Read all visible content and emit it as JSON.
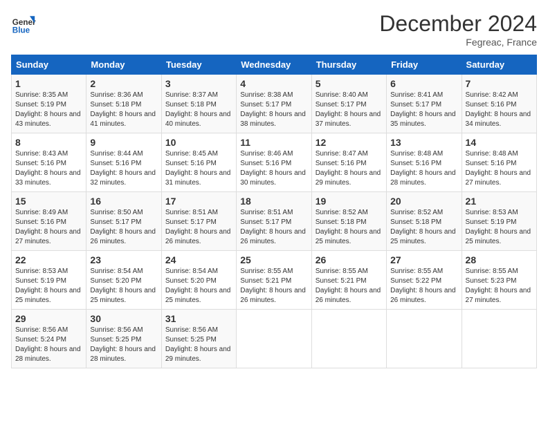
{
  "header": {
    "logo_line1": "General",
    "logo_line2": "Blue",
    "month": "December 2024",
    "location": "Fegreac, France"
  },
  "weekdays": [
    "Sunday",
    "Monday",
    "Tuesday",
    "Wednesday",
    "Thursday",
    "Friday",
    "Saturday"
  ],
  "weeks": [
    [
      {
        "day": "1",
        "sunrise": "Sunrise: 8:35 AM",
        "sunset": "Sunset: 5:19 PM",
        "daylight": "Daylight: 8 hours and 43 minutes."
      },
      {
        "day": "2",
        "sunrise": "Sunrise: 8:36 AM",
        "sunset": "Sunset: 5:18 PM",
        "daylight": "Daylight: 8 hours and 41 minutes."
      },
      {
        "day": "3",
        "sunrise": "Sunrise: 8:37 AM",
        "sunset": "Sunset: 5:18 PM",
        "daylight": "Daylight: 8 hours and 40 minutes."
      },
      {
        "day": "4",
        "sunrise": "Sunrise: 8:38 AM",
        "sunset": "Sunset: 5:17 PM",
        "daylight": "Daylight: 8 hours and 38 minutes."
      },
      {
        "day": "5",
        "sunrise": "Sunrise: 8:40 AM",
        "sunset": "Sunset: 5:17 PM",
        "daylight": "Daylight: 8 hours and 37 minutes."
      },
      {
        "day": "6",
        "sunrise": "Sunrise: 8:41 AM",
        "sunset": "Sunset: 5:17 PM",
        "daylight": "Daylight: 8 hours and 35 minutes."
      },
      {
        "day": "7",
        "sunrise": "Sunrise: 8:42 AM",
        "sunset": "Sunset: 5:16 PM",
        "daylight": "Daylight: 8 hours and 34 minutes."
      }
    ],
    [
      {
        "day": "8",
        "sunrise": "Sunrise: 8:43 AM",
        "sunset": "Sunset: 5:16 PM",
        "daylight": "Daylight: 8 hours and 33 minutes."
      },
      {
        "day": "9",
        "sunrise": "Sunrise: 8:44 AM",
        "sunset": "Sunset: 5:16 PM",
        "daylight": "Daylight: 8 hours and 32 minutes."
      },
      {
        "day": "10",
        "sunrise": "Sunrise: 8:45 AM",
        "sunset": "Sunset: 5:16 PM",
        "daylight": "Daylight: 8 hours and 31 minutes."
      },
      {
        "day": "11",
        "sunrise": "Sunrise: 8:46 AM",
        "sunset": "Sunset: 5:16 PM",
        "daylight": "Daylight: 8 hours and 30 minutes."
      },
      {
        "day": "12",
        "sunrise": "Sunrise: 8:47 AM",
        "sunset": "Sunset: 5:16 PM",
        "daylight": "Daylight: 8 hours and 29 minutes."
      },
      {
        "day": "13",
        "sunrise": "Sunrise: 8:48 AM",
        "sunset": "Sunset: 5:16 PM",
        "daylight": "Daylight: 8 hours and 28 minutes."
      },
      {
        "day": "14",
        "sunrise": "Sunrise: 8:48 AM",
        "sunset": "Sunset: 5:16 PM",
        "daylight": "Daylight: 8 hours and 27 minutes."
      }
    ],
    [
      {
        "day": "15",
        "sunrise": "Sunrise: 8:49 AM",
        "sunset": "Sunset: 5:16 PM",
        "daylight": "Daylight: 8 hours and 27 minutes."
      },
      {
        "day": "16",
        "sunrise": "Sunrise: 8:50 AM",
        "sunset": "Sunset: 5:17 PM",
        "daylight": "Daylight: 8 hours and 26 minutes."
      },
      {
        "day": "17",
        "sunrise": "Sunrise: 8:51 AM",
        "sunset": "Sunset: 5:17 PM",
        "daylight": "Daylight: 8 hours and 26 minutes."
      },
      {
        "day": "18",
        "sunrise": "Sunrise: 8:51 AM",
        "sunset": "Sunset: 5:17 PM",
        "daylight": "Daylight: 8 hours and 26 minutes."
      },
      {
        "day": "19",
        "sunrise": "Sunrise: 8:52 AM",
        "sunset": "Sunset: 5:18 PM",
        "daylight": "Daylight: 8 hours and 25 minutes."
      },
      {
        "day": "20",
        "sunrise": "Sunrise: 8:52 AM",
        "sunset": "Sunset: 5:18 PM",
        "daylight": "Daylight: 8 hours and 25 minutes."
      },
      {
        "day": "21",
        "sunrise": "Sunrise: 8:53 AM",
        "sunset": "Sunset: 5:19 PM",
        "daylight": "Daylight: 8 hours and 25 minutes."
      }
    ],
    [
      {
        "day": "22",
        "sunrise": "Sunrise: 8:53 AM",
        "sunset": "Sunset: 5:19 PM",
        "daylight": "Daylight: 8 hours and 25 minutes."
      },
      {
        "day": "23",
        "sunrise": "Sunrise: 8:54 AM",
        "sunset": "Sunset: 5:20 PM",
        "daylight": "Daylight: 8 hours and 25 minutes."
      },
      {
        "day": "24",
        "sunrise": "Sunrise: 8:54 AM",
        "sunset": "Sunset: 5:20 PM",
        "daylight": "Daylight: 8 hours and 25 minutes."
      },
      {
        "day": "25",
        "sunrise": "Sunrise: 8:55 AM",
        "sunset": "Sunset: 5:21 PM",
        "daylight": "Daylight: 8 hours and 26 minutes."
      },
      {
        "day": "26",
        "sunrise": "Sunrise: 8:55 AM",
        "sunset": "Sunset: 5:21 PM",
        "daylight": "Daylight: 8 hours and 26 minutes."
      },
      {
        "day": "27",
        "sunrise": "Sunrise: 8:55 AM",
        "sunset": "Sunset: 5:22 PM",
        "daylight": "Daylight: 8 hours and 26 minutes."
      },
      {
        "day": "28",
        "sunrise": "Sunrise: 8:55 AM",
        "sunset": "Sunset: 5:23 PM",
        "daylight": "Daylight: 8 hours and 27 minutes."
      }
    ],
    [
      {
        "day": "29",
        "sunrise": "Sunrise: 8:56 AM",
        "sunset": "Sunset: 5:24 PM",
        "daylight": "Daylight: 8 hours and 28 minutes."
      },
      {
        "day": "30",
        "sunrise": "Sunrise: 8:56 AM",
        "sunset": "Sunset: 5:25 PM",
        "daylight": "Daylight: 8 hours and 28 minutes."
      },
      {
        "day": "31",
        "sunrise": "Sunrise: 8:56 AM",
        "sunset": "Sunset: 5:25 PM",
        "daylight": "Daylight: 8 hours and 29 minutes."
      },
      null,
      null,
      null,
      null
    ]
  ]
}
